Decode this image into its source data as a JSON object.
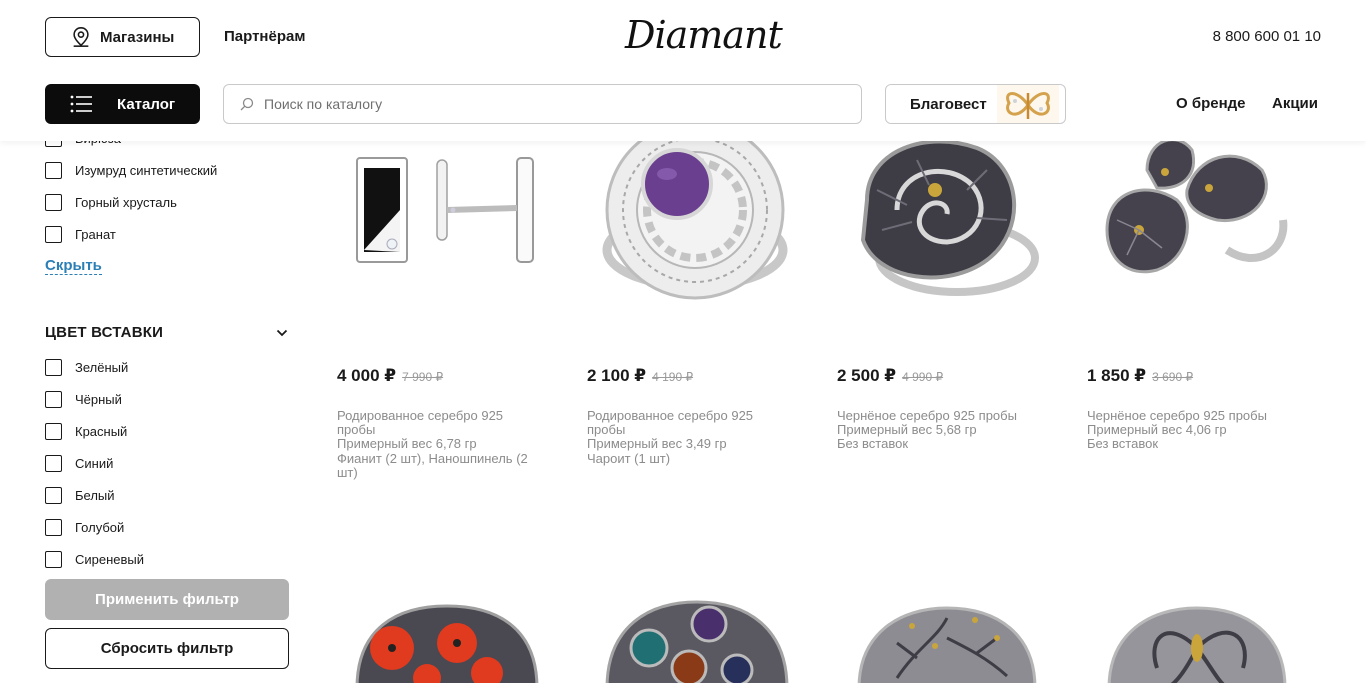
{
  "header": {
    "stores_label": "Магазины",
    "partners_label": "Партнёрам",
    "logo_text": "Diamant",
    "phone": "8 800 600 01 10",
    "catalog_label": "Каталог",
    "search_placeholder": "Поиск по каталогу",
    "brand_label": "Благовест",
    "about_label": "О бренде",
    "sales_label": "Акции"
  },
  "sidebar": {
    "insert_partial": "Бирюза",
    "inserts": [
      "Изумруд синтетический",
      "Горный хрусталь",
      "Гранат"
    ],
    "hide_label": "Скрыть",
    "color_section_title": "ЦВЕТ ВСТАВКИ",
    "colors": [
      "Зелёный",
      "Чёрный",
      "Красный",
      "Синий",
      "Белый",
      "Голубой",
      "Сиреневый"
    ],
    "apply_label": "Применить фильтр",
    "reset_label": "Сбросить фильтр"
  },
  "products": [
    {
      "price": "4 000 ₽",
      "old_price": "7 990 ₽",
      "desc_lines": [
        "Родированное серебро 925 пробы",
        "Примерный вес 6,78 гр",
        "Фианит (2 шт), Наношпинель (2 шт)"
      ],
      "image": "cufflinks-icon"
    },
    {
      "price": "2 100 ₽",
      "old_price": "4 190 ₽",
      "desc_lines": [
        "Родированное серебро 925 пробы",
        "Примерный вес 3,49 гр",
        "Чароит (1 шт)"
      ],
      "image": "purple-stone-ring-icon"
    },
    {
      "price": "2 500 ₽",
      "old_price": "4 990 ₽",
      "desc_lines": [
        "Чернёное серебро 925 пробы",
        "Примерный вес 5,68 гр",
        "Без вставок"
      ],
      "image": "spiral-ring-icon"
    },
    {
      "price": "1 850 ₽",
      "old_price": "3 690 ₽",
      "desc_lines": [
        "Чернёное серебро 925 пробы",
        "Примерный вес 4,06 гр",
        "Без вставок"
      ],
      "image": "leaves-ring-icon"
    }
  ],
  "bottom_products": [
    "poppy-ring-icon",
    "enamel-circles-ring-icon",
    "tree-ring-icon",
    "flower-ring-icon"
  ],
  "colors": {
    "accent_link": "#2b7fb5",
    "catalog_bg": "#0c0c0c",
    "apply_disabled": "#b1b1b1",
    "amethyst": "#6b3f8f",
    "poppy_red": "#e03a1f"
  }
}
